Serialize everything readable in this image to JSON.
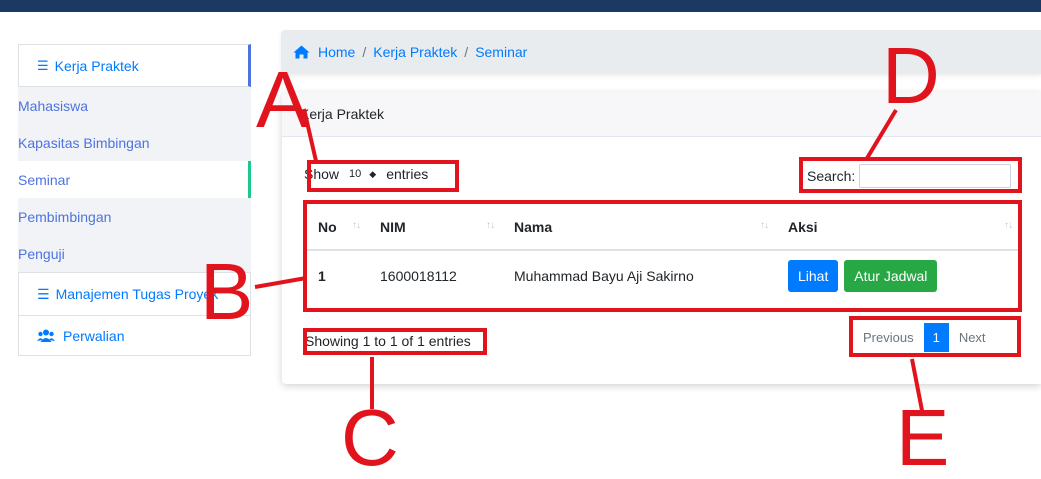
{
  "sidebar": {
    "header_label": "Kerja Praktek",
    "items": [
      {
        "label": "Mahasiswa"
      },
      {
        "label": "Kapasitas Bimbingan"
      },
      {
        "label": "Seminar"
      },
      {
        "label": "Pembimbingan"
      },
      {
        "label": "Penguji"
      }
    ],
    "management_label": "Manajemen Tugas Proyek",
    "perwalian_label": "Perwalian"
  },
  "breadcrumb": {
    "home": "Home",
    "separator": "/",
    "section": "Kerja Praktek",
    "current": "Seminar"
  },
  "card": {
    "title": "Kerja Praktek"
  },
  "length_control": {
    "show_label": "Show",
    "value": "10",
    "entries_label": "entries"
  },
  "search": {
    "label": "Search:",
    "value": ""
  },
  "table": {
    "columns": [
      "No",
      "NIM",
      "Nama",
      "Aksi"
    ],
    "rows": [
      {
        "no": "1",
        "nim": "1600018112",
        "nama": "Muhammad Bayu Aji Sakirno",
        "actions": [
          "Lihat",
          "Atur Jadwal"
        ]
      }
    ]
  },
  "info": "Showing 1 to 1 of 1 entries",
  "pagination": {
    "previous": "Previous",
    "current": "1",
    "next": "Next"
  },
  "annotations": {
    "a": "A",
    "b": "B",
    "c": "C",
    "d": "D",
    "e": "E"
  },
  "colors": {
    "accent": "#007bff",
    "success": "#28a745",
    "annotation": "#e1141d",
    "topbar": "#1a3a64"
  }
}
